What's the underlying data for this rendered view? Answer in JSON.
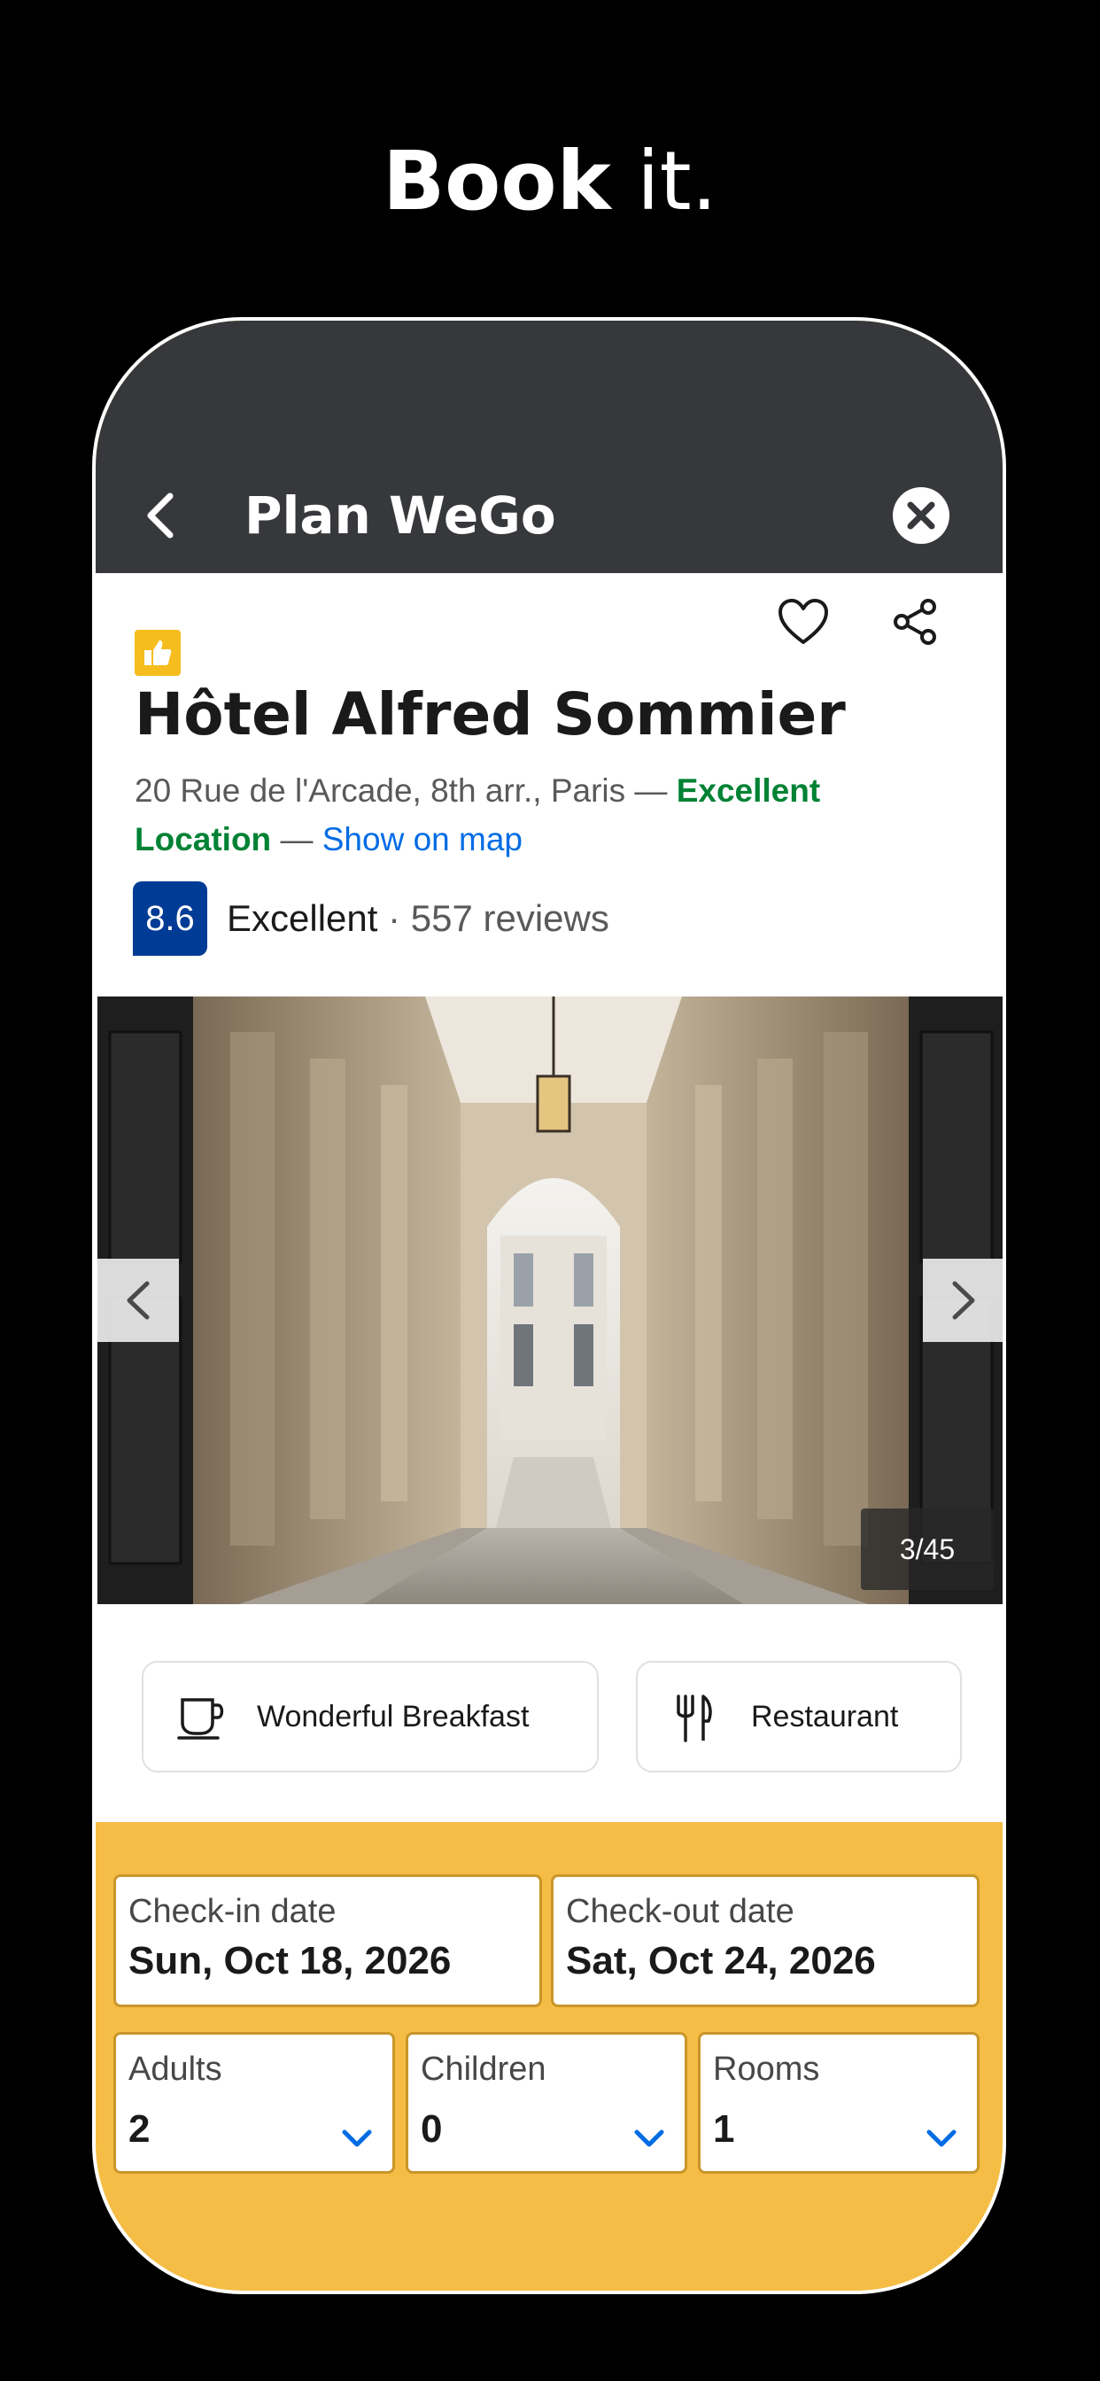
{
  "headline": {
    "bold": "Book",
    "light": "it."
  },
  "header": {
    "title": "Plan WeGo"
  },
  "hotel": {
    "name": "Hôtel Alfred Sommier",
    "address": "20 Rue de l'Arcade, 8th arr., Paris — ",
    "location_label": "Excellent Location",
    "separator": " — ",
    "map_link": "Show on map",
    "score": "8.6",
    "rating_word": "Excellent",
    "reviews": " · 557 reviews"
  },
  "gallery": {
    "counter": "3/45"
  },
  "facilities": [
    {
      "label": "Wonderful Breakfast",
      "icon": "coffee-cup-icon"
    },
    {
      "label": "Restaurant",
      "icon": "fork-knife-icon"
    }
  ],
  "search": {
    "checkin": {
      "label": "Check-in date",
      "value": "Sun, Oct 18, 2026"
    },
    "checkout": {
      "label": "Check-out date",
      "value": "Sat, Oct 24, 2026"
    },
    "adults": {
      "label": "Adults",
      "value": "2"
    },
    "children": {
      "label": "Children",
      "value": "0"
    },
    "rooms": {
      "label": "Rooms",
      "value": "1"
    }
  },
  "colors": {
    "background": "#000000",
    "topbar": "#36383b",
    "accent_yellow": "#f5bd45",
    "score_blue": "#003b95",
    "location_green": "#008234",
    "link_blue": "#006ce4"
  }
}
